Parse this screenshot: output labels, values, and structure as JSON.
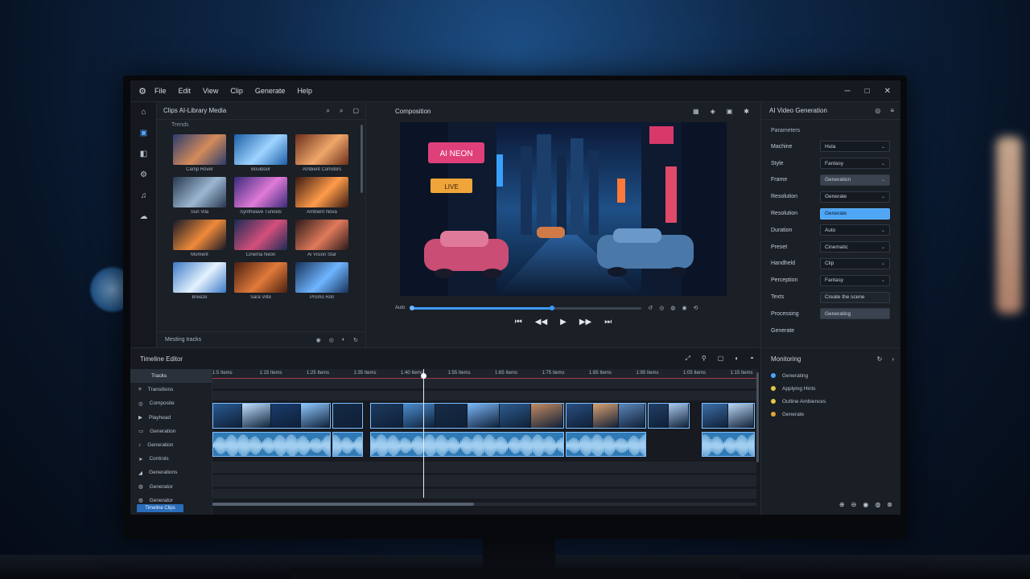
{
  "menu": {
    "logo_icon": "gear-icon",
    "items": [
      "File",
      "Edit",
      "View",
      "Clip",
      "Generate",
      "Help"
    ],
    "window_controls": [
      "─",
      "□",
      "✕"
    ]
  },
  "media_panel": {
    "title": "Clips   AI-Library Media",
    "subheading": "Trends",
    "tools": [
      "⌕",
      "⌕",
      "▢"
    ],
    "thumbnails": [
      {
        "caption": "Camp Rover",
        "colors": [
          "#2b3c6e",
          "#d48b5a"
        ]
      },
      {
        "caption": "Bouldoor",
        "colors": [
          "#1c5fa8",
          "#9fd4ff"
        ]
      },
      {
        "caption": "Ambient Corridors",
        "colors": [
          "#6b2f1c",
          "#f0a76a"
        ]
      },
      {
        "caption": "Sun Vila",
        "colors": [
          "#27384f",
          "#9db7d2"
        ]
      },
      {
        "caption": "Synthwave Tunnels",
        "colors": [
          "#3a2a7a",
          "#e07ad8"
        ]
      },
      {
        "caption": "Ambient Nova",
        "colors": [
          "#3a1a12",
          "#ff9c4a"
        ]
      },
      {
        "caption": "Moment",
        "colors": [
          "#141826",
          "#f08a3a"
        ]
      },
      {
        "caption": "Cinema Neon",
        "colors": [
          "#1a2b55",
          "#d44f7b"
        ]
      },
      {
        "caption": "Ai Vision Star",
        "colors": [
          "#2a1a1a",
          "#e07a5a"
        ]
      },
      {
        "caption": "Breeze",
        "colors": [
          "#3b79c5",
          "#e4f2ff"
        ]
      },
      {
        "caption": "Sara Vilte",
        "colors": [
          "#4a2010",
          "#e07a3a"
        ]
      },
      {
        "caption": "Promo Roll",
        "colors": [
          "#17325a",
          "#6fb5ff"
        ]
      }
    ],
    "footer_label": "Mesting tracks",
    "footer_icons": [
      "◉",
      "◎",
      "◐",
      "↻"
    ]
  },
  "preview": {
    "title": "Composition",
    "tools": [
      "▦",
      "◈",
      "▣",
      "✱"
    ],
    "time_label": "Auto",
    "progress": 0.61,
    "scrub_icons": [
      "↺",
      "◎",
      "◍",
      "◉",
      "⟲"
    ],
    "transport": [
      "⏮",
      "◀◀",
      "▶",
      "▶▶",
      "⏭"
    ],
    "signs": [
      "AI NEON",
      "LIVE"
    ]
  },
  "params_panel": {
    "title": "AI Video Generation",
    "head_icons": [
      "◎",
      "≡"
    ],
    "section_label": "Parameters",
    "rows": [
      {
        "label": "Machine",
        "value": "Hula",
        "style": "normal"
      },
      {
        "label": "Style",
        "value": "Fantasy",
        "style": "normal"
      },
      {
        "label": "Frame",
        "value": "Generation",
        "style": "dark"
      },
      {
        "label": "Resolution",
        "value": "Generate",
        "style": "normal"
      },
      {
        "label": "Resolution",
        "value": "Generate",
        "style": "highlight"
      },
      {
        "label": "Duration",
        "value": "Auto",
        "style": "normal"
      },
      {
        "label": "Preset",
        "value": "Cinematic",
        "style": "normal"
      },
      {
        "label": "Handheld",
        "value": "Clip",
        "style": "normal"
      },
      {
        "label": "Perception",
        "value": "Fantasy",
        "style": "normal"
      },
      {
        "label": "Texts",
        "value": "Create the scene",
        "style": "plain"
      },
      {
        "label": "Processing",
        "value": "Generating",
        "style": "dark"
      },
      {
        "label": "Generate",
        "value": "",
        "style": "none"
      }
    ]
  },
  "timeline": {
    "title": "Timeline Editor",
    "tools": [
      "⤢",
      "⚲",
      "▢",
      "◐",
      "◓"
    ],
    "ruler_ticks": [
      "1:5 Items",
      "1:15 Items",
      "1:25 Items",
      "1:35 Items",
      "1:45 Items",
      "1:55 Items",
      "1:65 Items",
      "1:75 Items",
      "1:85 Items",
      "1:95 Items",
      "1:05 Items",
      "1:15 Items"
    ],
    "track_labels": [
      {
        "icon": "",
        "label": "Tracks"
      },
      {
        "icon": "≡",
        "label": "Transitions"
      },
      {
        "icon": "◎",
        "label": "Composite"
      },
      {
        "icon": "▶",
        "label": "Playhead"
      },
      {
        "icon": "▭",
        "label": "Generation"
      },
      {
        "icon": "♪",
        "label": "Generation"
      },
      {
        "icon": "➤",
        "label": "Controls"
      },
      {
        "icon": "◢",
        "label": "Generations"
      },
      {
        "icon": "◍",
        "label": "Generator"
      },
      {
        "icon": "◍",
        "label": "Generator"
      }
    ],
    "playhead_label": "1:40",
    "button_label": "Timeline Clips",
    "video_clips": [
      {
        "start": 0.0,
        "end": 0.22,
        "frames": [
          "#2a5a92",
          "#bfe0ff",
          "#1a3c6e",
          "#8fc8ff"
        ]
      },
      {
        "start": 0.22,
        "end": 0.28,
        "frames": [
          "#152a45"
        ]
      },
      {
        "start": 0.29,
        "end": 0.65,
        "frames": [
          "#1e3a5f",
          "#4b8dcf",
          "#182c48",
          "#7bb6f5",
          "#2f5c8f",
          "#c48b63"
        ]
      },
      {
        "start": 0.65,
        "end": 0.8,
        "frames": [
          "#2a4f80",
          "#d9a070",
          "#5d86b8"
        ]
      },
      {
        "start": 0.8,
        "end": 0.88,
        "frames": [
          "#243e66",
          "#aac9ee"
        ]
      },
      {
        "start": 0.9,
        "end": 1.0,
        "frames": [
          "#3d6ea8",
          "#bcd8f5"
        ]
      }
    ],
    "audio_clips": [
      {
        "start": 0.0,
        "end": 0.22
      },
      {
        "start": 0.22,
        "end": 0.28
      },
      {
        "start": 0.29,
        "end": 0.65
      },
      {
        "start": 0.65,
        "end": 0.8
      },
      {
        "start": 0.9,
        "end": 1.0
      }
    ]
  },
  "monitor_panel": {
    "title": "Monitoring",
    "head_icons": [
      "↻",
      "›"
    ],
    "items": [
      {
        "label": "Generating",
        "color": "#4aa8ff"
      },
      {
        "label": "Applying Hints",
        "color": "#e2c84a"
      },
      {
        "label": "Outline Ambiences",
        "color": "#e2c84a"
      },
      {
        "label": "Generate",
        "color": "#e2a83a"
      }
    ],
    "bottom_icons": [
      "⊕",
      "⊖",
      "◉",
      "◍",
      "⊗"
    ]
  }
}
